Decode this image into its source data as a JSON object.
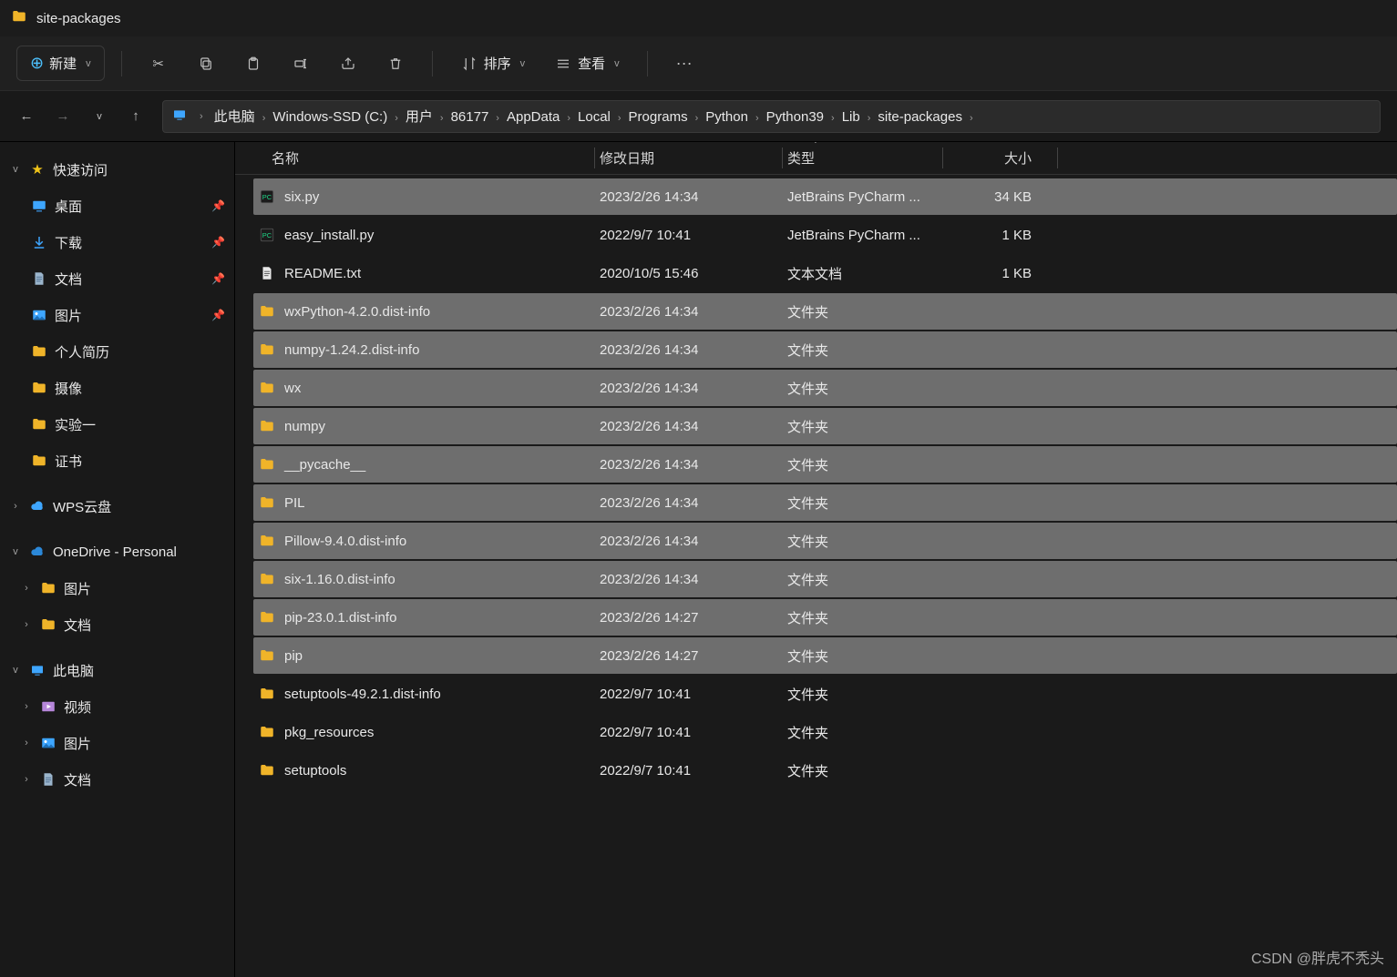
{
  "window": {
    "title": "site-packages"
  },
  "toolbar": {
    "new_label": "新建",
    "sort_label": "排序",
    "view_label": "查看"
  },
  "breadcrumb": [
    "此电脑",
    "Windows-SSD (C:)",
    "用户",
    "86177",
    "AppData",
    "Local",
    "Programs",
    "Python",
    "Python39",
    "Lib",
    "site-packages"
  ],
  "columns": {
    "name": "名称",
    "date": "修改日期",
    "type": "类型",
    "size": "大小"
  },
  "sidebar": {
    "quick_access": {
      "label": "快速访问",
      "expanded": true
    },
    "quick_items": [
      {
        "label": "桌面",
        "icon": "desktop",
        "pinned": true
      },
      {
        "label": "下载",
        "icon": "download",
        "pinned": true
      },
      {
        "label": "文档",
        "icon": "doc",
        "pinned": true
      },
      {
        "label": "图片",
        "icon": "pic",
        "pinned": true
      },
      {
        "label": "个人简历",
        "icon": "folder",
        "pinned": false
      },
      {
        "label": "摄像",
        "icon": "folder",
        "pinned": false
      },
      {
        "label": "实验一",
        "icon": "folder",
        "pinned": false
      },
      {
        "label": "证书",
        "icon": "folder",
        "pinned": false
      }
    ],
    "wps": {
      "label": "WPS云盘",
      "expanded": false
    },
    "onedrive": {
      "label": "OneDrive - Personal",
      "expanded": true,
      "children": [
        {
          "label": "图片",
          "icon": "folder"
        },
        {
          "label": "文档",
          "icon": "folder"
        }
      ]
    },
    "thispc": {
      "label": "此电脑",
      "expanded": true,
      "children": [
        {
          "label": "视频",
          "icon": "video"
        },
        {
          "label": "图片",
          "icon": "pic"
        },
        {
          "label": "文档",
          "icon": "doc"
        }
      ]
    }
  },
  "files": [
    {
      "name": "six.py",
      "date": "2023/2/26 14:34",
      "type": "JetBrains PyCharm ...",
      "size": "34 KB",
      "icon": "pycharm",
      "selected": true
    },
    {
      "name": "easy_install.py",
      "date": "2022/9/7 10:41",
      "type": "JetBrains PyCharm ...",
      "size": "1 KB",
      "icon": "pycharm",
      "selected": false
    },
    {
      "name": "README.txt",
      "date": "2020/10/5 15:46",
      "type": "文本文档",
      "size": "1 KB",
      "icon": "txt",
      "selected": false
    },
    {
      "name": "wxPython-4.2.0.dist-info",
      "date": "2023/2/26 14:34",
      "type": "文件夹",
      "size": "",
      "icon": "folder",
      "selected": true
    },
    {
      "name": "numpy-1.24.2.dist-info",
      "date": "2023/2/26 14:34",
      "type": "文件夹",
      "size": "",
      "icon": "folder",
      "selected": true
    },
    {
      "name": "wx",
      "date": "2023/2/26 14:34",
      "type": "文件夹",
      "size": "",
      "icon": "folder",
      "selected": true
    },
    {
      "name": "numpy",
      "date": "2023/2/26 14:34",
      "type": "文件夹",
      "size": "",
      "icon": "folder",
      "selected": true
    },
    {
      "name": "__pycache__",
      "date": "2023/2/26 14:34",
      "type": "文件夹",
      "size": "",
      "icon": "folder",
      "selected": true
    },
    {
      "name": "PIL",
      "date": "2023/2/26 14:34",
      "type": "文件夹",
      "size": "",
      "icon": "folder",
      "selected": true
    },
    {
      "name": "Pillow-9.4.0.dist-info",
      "date": "2023/2/26 14:34",
      "type": "文件夹",
      "size": "",
      "icon": "folder",
      "selected": true
    },
    {
      "name": "six-1.16.0.dist-info",
      "date": "2023/2/26 14:34",
      "type": "文件夹",
      "size": "",
      "icon": "folder",
      "selected": true
    },
    {
      "name": "pip-23.0.1.dist-info",
      "date": "2023/2/26 14:27",
      "type": "文件夹",
      "size": "",
      "icon": "folder",
      "selected": true
    },
    {
      "name": "pip",
      "date": "2023/2/26 14:27",
      "type": "文件夹",
      "size": "",
      "icon": "folder",
      "selected": true
    },
    {
      "name": "setuptools-49.2.1.dist-info",
      "date": "2022/9/7 10:41",
      "type": "文件夹",
      "size": "",
      "icon": "folder",
      "selected": false
    },
    {
      "name": "pkg_resources",
      "date": "2022/9/7 10:41",
      "type": "文件夹",
      "size": "",
      "icon": "folder",
      "selected": false
    },
    {
      "name": "setuptools",
      "date": "2022/9/7 10:41",
      "type": "文件夹",
      "size": "",
      "icon": "folder",
      "selected": false
    }
  ],
  "watermark": "CSDN @胖虎不秃头"
}
